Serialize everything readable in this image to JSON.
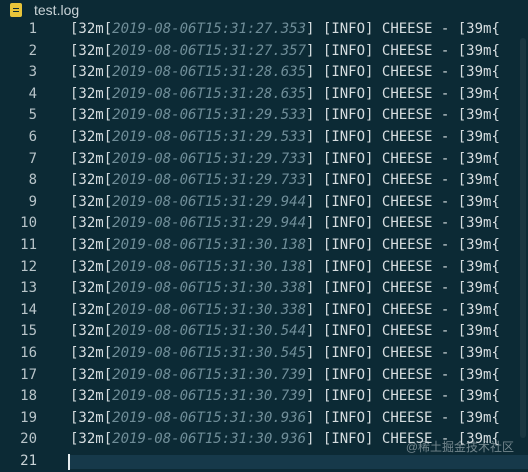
{
  "tab": {
    "title": "test.log",
    "icon": "document-icon"
  },
  "lines": [
    {
      "n": "1",
      "pre": "[32m[",
      "ts": "2019-08-06T15:31:27.353",
      "post": "] [INFO] CHEESE - [39m{"
    },
    {
      "n": "2",
      "pre": "[32m[",
      "ts": "2019-08-06T15:31:27.357",
      "post": "] [INFO] CHEESE - [39m{"
    },
    {
      "n": "3",
      "pre": "[32m[",
      "ts": "2019-08-06T15:31:28.635",
      "post": "] [INFO] CHEESE - [39m{"
    },
    {
      "n": "4",
      "pre": "[32m[",
      "ts": "2019-08-06T15:31:28.635",
      "post": "] [INFO] CHEESE - [39m{"
    },
    {
      "n": "5",
      "pre": "[32m[",
      "ts": "2019-08-06T15:31:29.533",
      "post": "] [INFO] CHEESE - [39m{"
    },
    {
      "n": "6",
      "pre": "[32m[",
      "ts": "2019-08-06T15:31:29.533",
      "post": "] [INFO] CHEESE - [39m{"
    },
    {
      "n": "7",
      "pre": "[32m[",
      "ts": "2019-08-06T15:31:29.733",
      "post": "] [INFO] CHEESE - [39m{"
    },
    {
      "n": "8",
      "pre": "[32m[",
      "ts": "2019-08-06T15:31:29.733",
      "post": "] [INFO] CHEESE - [39m{"
    },
    {
      "n": "9",
      "pre": "[32m[",
      "ts": "2019-08-06T15:31:29.944",
      "post": "] [INFO] CHEESE - [39m{"
    },
    {
      "n": "10",
      "pre": "[32m[",
      "ts": "2019-08-06T15:31:29.944",
      "post": "] [INFO] CHEESE - [39m{"
    },
    {
      "n": "11",
      "pre": "[32m[",
      "ts": "2019-08-06T15:31:30.138",
      "post": "] [INFO] CHEESE - [39m{"
    },
    {
      "n": "12",
      "pre": "[32m[",
      "ts": "2019-08-06T15:31:30.138",
      "post": "] [INFO] CHEESE - [39m{"
    },
    {
      "n": "13",
      "pre": "[32m[",
      "ts": "2019-08-06T15:31:30.338",
      "post": "] [INFO] CHEESE - [39m{"
    },
    {
      "n": "14",
      "pre": "[32m[",
      "ts": "2019-08-06T15:31:30.338",
      "post": "] [INFO] CHEESE - [39m{"
    },
    {
      "n": "15",
      "pre": "[32m[",
      "ts": "2019-08-06T15:31:30.544",
      "post": "] [INFO] CHEESE - [39m{"
    },
    {
      "n": "16",
      "pre": "[32m[",
      "ts": "2019-08-06T15:31:30.545",
      "post": "] [INFO] CHEESE - [39m{"
    },
    {
      "n": "17",
      "pre": "[32m[",
      "ts": "2019-08-06T15:31:30.739",
      "post": "] [INFO] CHEESE - [39m{"
    },
    {
      "n": "18",
      "pre": "[32m[",
      "ts": "2019-08-06T15:31:30.739",
      "post": "] [INFO] CHEESE - [39m{"
    },
    {
      "n": "19",
      "pre": "[32m[",
      "ts": "2019-08-06T15:31:30.936",
      "post": "] [INFO] CHEESE - [39m{"
    },
    {
      "n": "20",
      "pre": "[32m[",
      "ts": "2019-08-06T15:31:30.936",
      "post": "] [INFO] CHEESE - [39m{"
    },
    {
      "n": "21",
      "pre": "",
      "ts": "",
      "post": ""
    }
  ],
  "watermark": "@稀土掘金技术社区",
  "colors": {
    "background": "#0c2a35",
    "text": "#d6dde0",
    "timestamp": "#6f8d98",
    "icon": "#e8c43a"
  }
}
